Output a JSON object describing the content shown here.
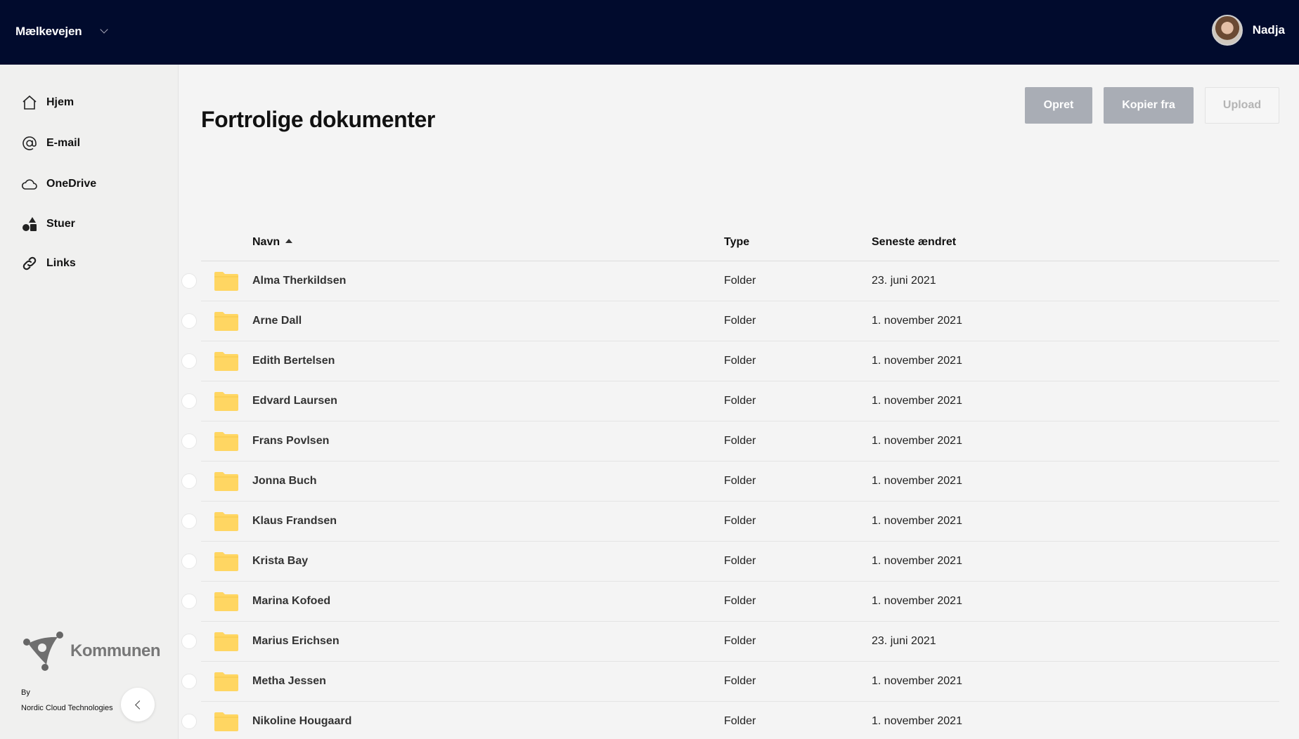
{
  "header": {
    "org_name": "Mælkevejen",
    "user_name": "Nadja"
  },
  "sidebar": {
    "items": [
      {
        "label": "Hjem",
        "icon": "home-icon"
      },
      {
        "label": "E-mail",
        "icon": "at-sign-icon"
      },
      {
        "label": "OneDrive",
        "icon": "cloud-icon"
      },
      {
        "label": "Stuer",
        "icon": "shapes-icon"
      },
      {
        "label": "Links",
        "icon": "link-icon"
      }
    ],
    "logo_text": "Kommunen",
    "by_label": "By",
    "vendor": "Nordic Cloud Technologies"
  },
  "main": {
    "title": "Fortrolige dokumenter",
    "buttons": {
      "create": "Opret",
      "copy_from": "Kopier fra",
      "upload": "Upload"
    },
    "table": {
      "columns": {
        "name": "Navn",
        "type": "Type",
        "modified": "Seneste ændret"
      },
      "rows": [
        {
          "name": "Alma Therkildsen",
          "type": "Folder",
          "modified": "23. juni 2021"
        },
        {
          "name": "Arne Dall",
          "type": "Folder",
          "modified": "1. november 2021"
        },
        {
          "name": "Edith Bertelsen",
          "type": "Folder",
          "modified": "1. november 2021"
        },
        {
          "name": "Edvard Laursen",
          "type": "Folder",
          "modified": "1. november 2021"
        },
        {
          "name": "Frans Povlsen",
          "type": "Folder",
          "modified": "1. november 2021"
        },
        {
          "name": "Jonna Buch",
          "type": "Folder",
          "modified": "1. november 2021"
        },
        {
          "name": "Klaus Frandsen",
          "type": "Folder",
          "modified": "1. november 2021"
        },
        {
          "name": "Krista Bay",
          "type": "Folder",
          "modified": "1. november 2021"
        },
        {
          "name": "Marina Kofoed",
          "type": "Folder",
          "modified": "1. november 2021"
        },
        {
          "name": "Marius Erichsen",
          "type": "Folder",
          "modified": "23. juni 2021"
        },
        {
          "name": "Metha Jessen",
          "type": "Folder",
          "modified": "1. november 2021"
        },
        {
          "name": "Nikoline Hougaard",
          "type": "Folder",
          "modified": "1. november 2021"
        }
      ]
    }
  },
  "colors": {
    "topbar": "#010b2d",
    "folder": "#ffd662",
    "button_disabled": "#a9adb5"
  }
}
